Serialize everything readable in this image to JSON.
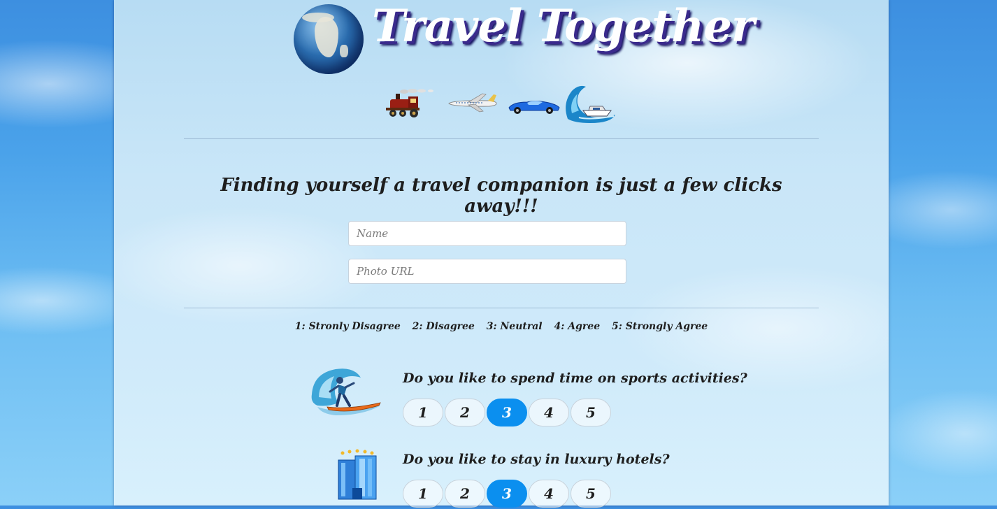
{
  "header": {
    "title": "Travel Together",
    "logo_icon": "globe-icon",
    "vehicle_icons": [
      "train-icon",
      "airplane-icon",
      "race-car-icon",
      "speedboat-icon"
    ]
  },
  "intro": {
    "tagline": "Finding yourself a travel companion is just a few clicks away!!!"
  },
  "form": {
    "name_placeholder": "Name",
    "name_value": "",
    "photo_placeholder": "Photo URL",
    "photo_value": ""
  },
  "scale_legend": [
    "1: Stronly Disagree",
    "2: Disagree",
    "3: Neutral",
    "4: Agree",
    "5: Strongly Agree"
  ],
  "questions": [
    {
      "text": "Do you like to spend time on sports activities?",
      "icon": "surfer-icon",
      "options": [
        "1",
        "2",
        "3",
        "4",
        "5"
      ],
      "selected": "3"
    },
    {
      "text": "Do you like to stay in luxury hotels?",
      "icon": "hotel-icon",
      "options": [
        "1",
        "2",
        "3",
        "4",
        "5"
      ],
      "selected": "3"
    }
  ],
  "colors": {
    "accent": "#0b8fef",
    "title_shadow": "#3a2a8c",
    "text": "#1e1e1e"
  }
}
